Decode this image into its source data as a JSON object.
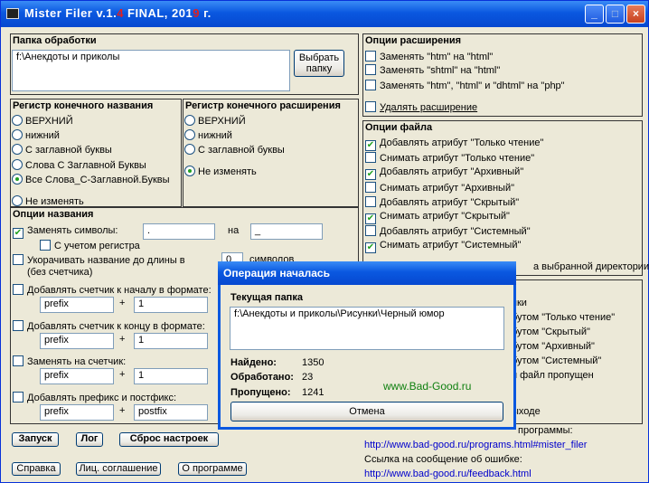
{
  "title": {
    "prefix": "Mister Filer v.1.",
    "red1": "4",
    "mid": " FINAL, 201",
    "red2": "9",
    "suffix": " г."
  },
  "titlebar_buttons": {
    "min": "_",
    "max": "□",
    "close": "×"
  },
  "folder": {
    "label": "Папка обработки",
    "value": "f:\\Анекдоты и приколы",
    "browse": "Выбрать папку"
  },
  "name_case": {
    "label": "Регистр конечного названия",
    "options": [
      "ВЕРХНИЙ",
      "нижний",
      "С заглавной буквы",
      "Слова С Заглавной Буквы",
      "Все Слова_С-Заглавной.Буквы",
      "Не изменять"
    ],
    "selected": 4
  },
  "ext_case": {
    "label": "Регистр конечного расширения",
    "options": [
      "ВЕРХНИЙ",
      "нижний",
      "С заглавной буквы",
      "Не изменять"
    ],
    "selected": 3
  },
  "name_opts": {
    "label": "Опции названия",
    "replace_symbols": "Заменять символы:",
    "replace_from": ".",
    "on": "на",
    "replace_to": "_",
    "case_sensitive": "С учетом регистра",
    "shorten": "Укорачивать название до длины в",
    "shorten_sub": "(без счетчика)",
    "shorten_value": "0",
    "symbols": "символов",
    "counter_start": "Добавлять счетчик к началу в формате:",
    "counter_end": "Добавлять счетчик к концу в формате:",
    "replace_counter": "Заменять на счетчик:",
    "prefix_postfix": "Добавлять префикс и постфикс:",
    "prefix": "prefix",
    "plus": "+",
    "one": "1",
    "postfix": "postfix"
  },
  "ext_opts": {
    "label": "Опции расширения",
    "items": [
      "Заменять \"htm\" на \"html\"",
      "Заменять \"shtml\" на \"html\"",
      "Заменять \"htm\", \"html\" и \"dhtml\" на \"php\"",
      "Удалять расширение"
    ]
  },
  "file_opts": {
    "label": "Опции файла",
    "items": [
      {
        "t": "Добавлять атрибут \"Только чтение\"",
        "c": true
      },
      {
        "t": "Снимать атрибут \"Только чтение\"",
        "c": false
      },
      {
        "t": "Добавлять атрибут \"Архивный\"",
        "c": true
      },
      {
        "t": "Снимать атрибут \"Архивный\"",
        "c": false
      },
      {
        "t": "Добавлять атрибут \"Скрытый\"",
        "c": false
      },
      {
        "t": "Снимать атрибут \"Скрытый\"",
        "c": true
      },
      {
        "t": "Добавлять атрибут \"Системный\"",
        "c": false
      },
      {
        "t": "Снимать атрибут \"Системный\"",
        "c": true
      }
    ],
    "partial": "а выбранной директории)"
  },
  "log_partial": [
    "пки",
    "бутом \"Только чтение\"",
    "бутом \"Скрытый\"",
    "бутом \"Архивный\"",
    "бутом \"Системный\"",
    "н файл пропущен",
    "ыходе"
  ],
  "actions": {
    "start": "Запуск",
    "log": "Лог",
    "reset": "Сброс настроек",
    "help": "Справка",
    "license": "Лиц. соглашение",
    "about": "О программе"
  },
  "links": {
    "prog_label": "программы:",
    "prog_url": "http://www.bad-good.ru/programs.html#mister_filer",
    "feedback_label": "Ссылка на сообщение об ошибке:",
    "feedback_url": "http://www.bad-good.ru/feedback.html"
  },
  "dialog": {
    "title": "Операция началась",
    "folder_label": "Текущая папка",
    "folder_value": "f:\\Анекдоты и приколы\\Рисунки\\Черный юмор",
    "found_label": "Найдено:",
    "found": "1350",
    "processed_label": "Обработано:",
    "processed": "23",
    "skipped_label": "Пропущено:",
    "skipped": "1241",
    "site": "www.Bad-Good.ru",
    "cancel": "Отмена"
  }
}
